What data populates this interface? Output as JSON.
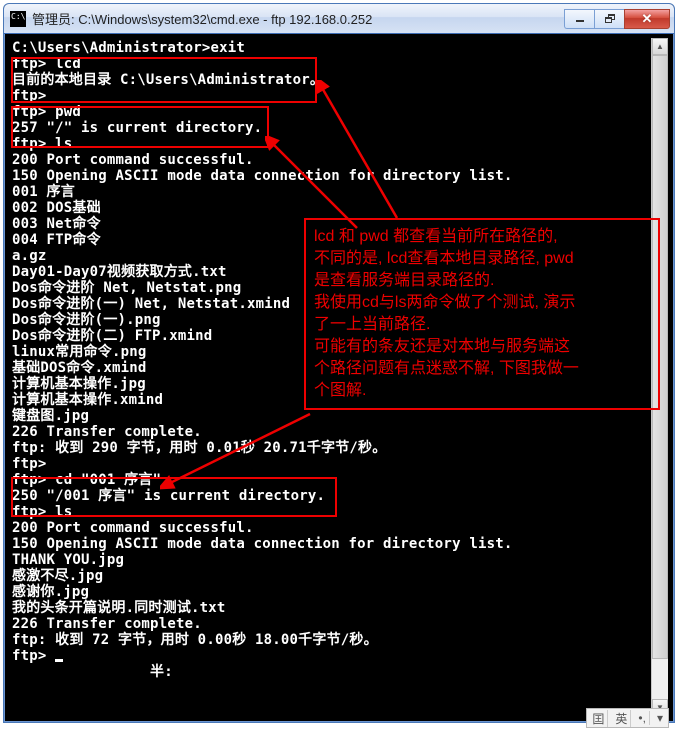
{
  "window": {
    "title": "管理员: C:\\Windows\\system32\\cmd.exe - ftp  192.168.0.252"
  },
  "terminal": {
    "lines": [
      "C:\\Users\\Administrator>exit",
      "ftp> lcd",
      "目前的本地目录 C:\\Users\\Administrator。",
      "ftp>",
      "ftp> pwd",
      "257 \"/\" is current directory.",
      "ftp> ls",
      "200 Port command successful.",
      "150 Opening ASCII mode data connection for directory list.",
      "001 序言",
      "002 DOS基础",
      "003 Net命令",
      "004 FTP命令",
      "a.gz",
      "Day01-Day07视频获取方式.txt",
      "Dos命令进阶 Net, Netstat.png",
      "Dos命令进阶(一) Net, Netstat.xmind",
      "Dos命令进阶(一).png",
      "Dos命令进阶(二) FTP.xmind",
      "linux常用命令.png",
      "基础DOS命令.xmind",
      "计算机基本操作.jpg",
      "计算机基本操作.xmind",
      "键盘图.jpg",
      "226 Transfer complete.",
      "ftp: 收到 290 字节，用时 0.01秒 20.71千字节/秒。",
      "ftp>",
      "ftp> cd \"001 序言\"",
      "250 \"/001 序言\" is current directory.",
      "ftp> ls",
      "200 Port command successful.",
      "150 Opening ASCII mode data connection for directory list.",
      "THANK YOU.jpg",
      "感激不尽.jpg",
      "感谢你.jpg",
      "我的头条开篇说明.同时测试.txt",
      "226 Transfer complete.",
      "ftp: 收到 72 字节，用时 0.00秒 18.00千字节/秒。",
      "ftp> _",
      "",
      "",
      "                半:"
    ]
  },
  "annotation": {
    "text": "lcd 和 pwd 都查看当前所在路径的,\n不同的是, lcd查看本地目录路径, pwd\n是查看服务端目录路径的.\n我使用cd与ls两命令做了个测试, 演示\n了一上当前路径.\n可能有的条友还是对本地与服务端这\n个路径问题有点迷惑不解, 下图我做一\n个图解."
  },
  "ime": {
    "k": "囯",
    "m": "英",
    "dot": "•,"
  }
}
